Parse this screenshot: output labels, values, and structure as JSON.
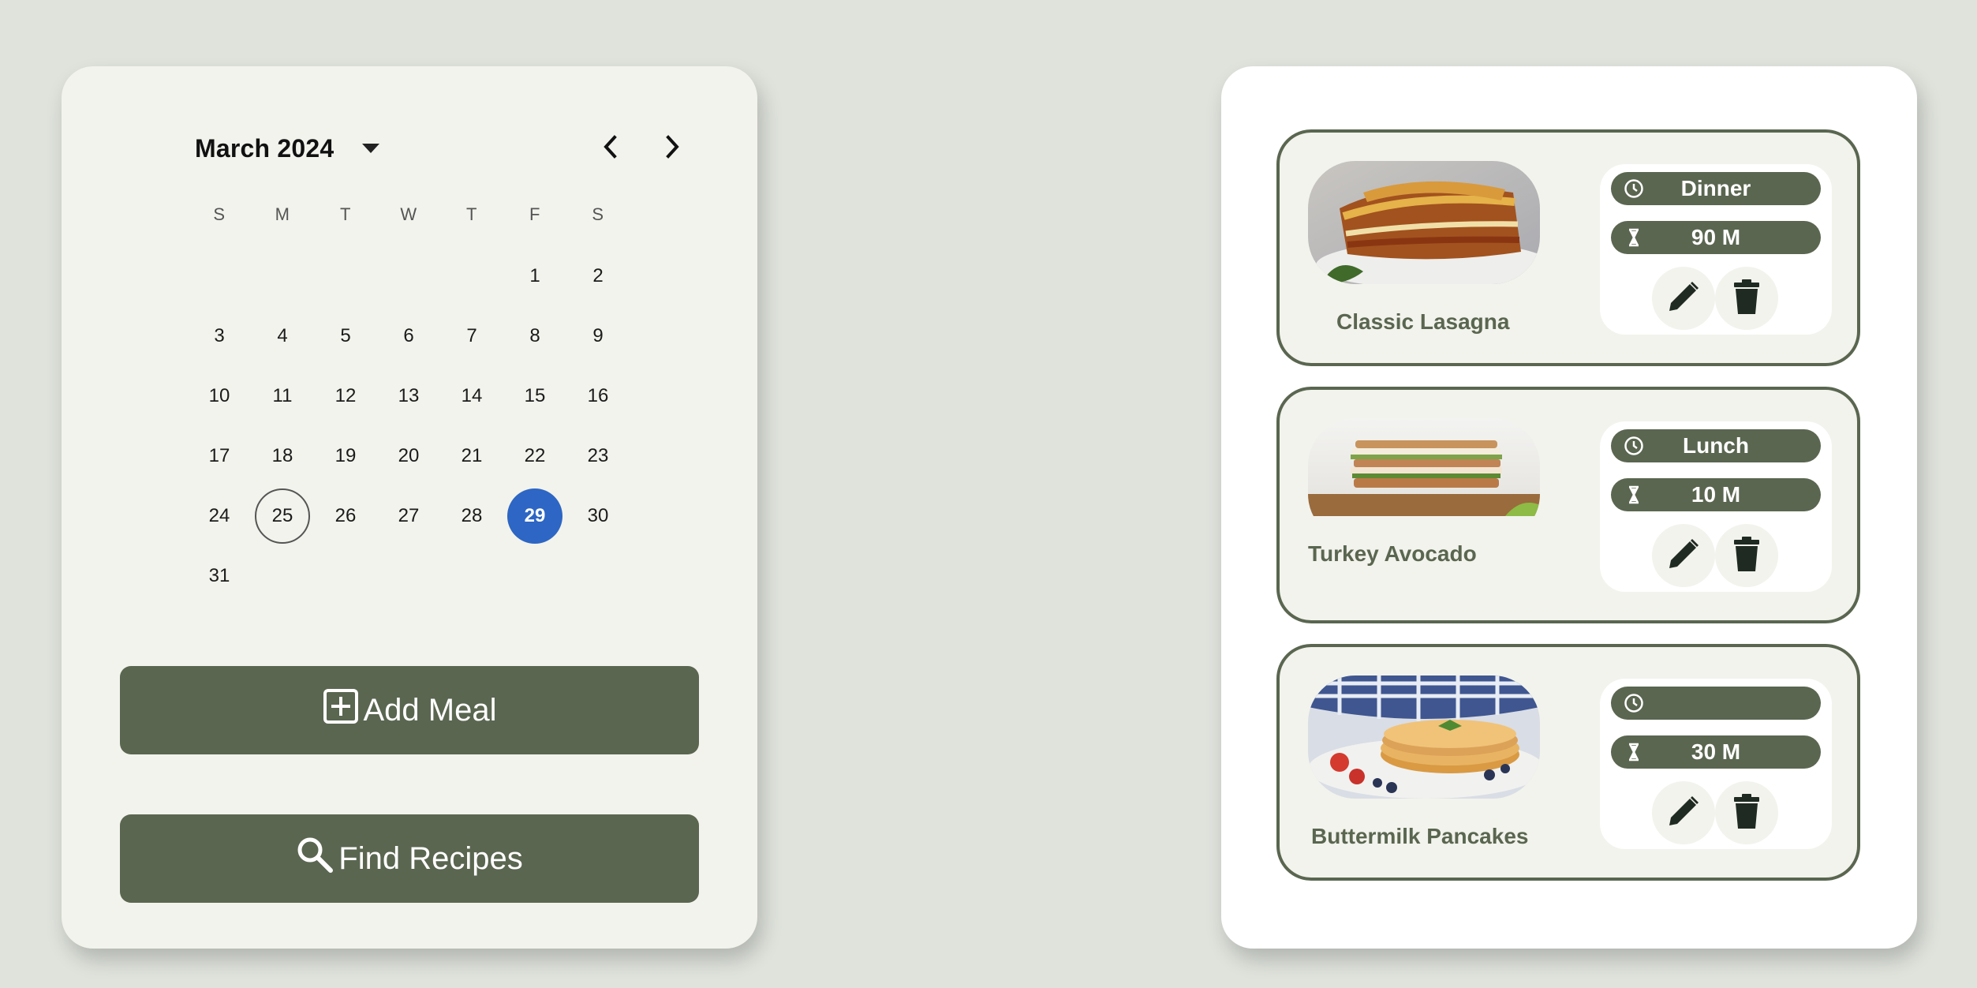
{
  "calendar": {
    "month_label": "March 2024",
    "prev_icon": "chevron-left-icon",
    "next_icon": "chevron-right-icon",
    "weekdays": [
      "S",
      "M",
      "T",
      "W",
      "T",
      "F",
      "S"
    ],
    "days": [
      "",
      "",
      "",
      "",
      "",
      "1",
      "2",
      "3",
      "4",
      "5",
      "6",
      "7",
      "8",
      "9",
      "10",
      "11",
      "12",
      "13",
      "14",
      "15",
      "16",
      "17",
      "18",
      "19",
      "20",
      "21",
      "22",
      "23",
      "24",
      "25",
      "26",
      "27",
      "28",
      "29",
      "30",
      "31"
    ],
    "today": "25",
    "selected": "29",
    "selected_color": "#2d66c4"
  },
  "actions": {
    "add_meal_label": "Add Meal",
    "find_recipes_label": "Find Recipes"
  },
  "meals": [
    {
      "name": "Classic Lasagna",
      "meal_type": "Dinner",
      "duration": "90 M",
      "photo": "lasagna-photo"
    },
    {
      "name": "Turkey Avocado",
      "meal_type": "Lunch",
      "duration": "10 M",
      "photo": "sandwich-photo"
    },
    {
      "name": "Buttermilk Pancakes",
      "meal_type": "",
      "duration": "30 M",
      "photo": "pancakes-photo"
    }
  ],
  "colors": {
    "accent": "#5a6650",
    "background": "#dfe3dc",
    "panel": "#f2f3ec"
  }
}
